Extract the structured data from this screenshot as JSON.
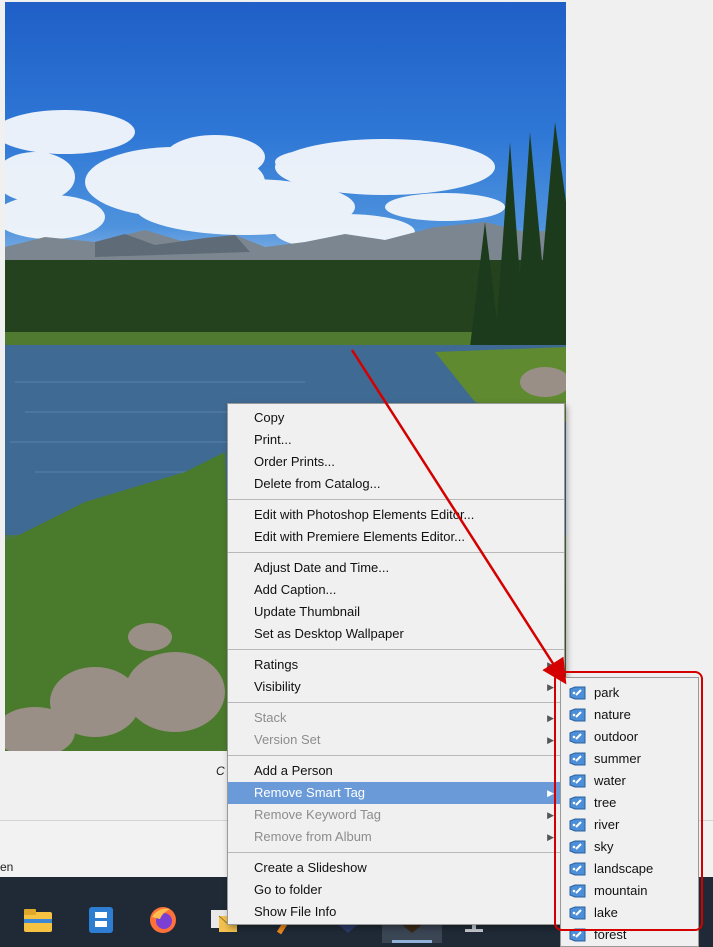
{
  "caption": "C",
  "status_text": "en",
  "context_menu": {
    "groups": [
      [
        {
          "label": "Copy",
          "disabled": false,
          "submenu": false
        },
        {
          "label": "Print...",
          "disabled": false,
          "submenu": false
        },
        {
          "label": "Order Prints...",
          "disabled": false,
          "submenu": false
        },
        {
          "label": "Delete from Catalog...",
          "disabled": false,
          "submenu": false
        }
      ],
      [
        {
          "label": "Edit with Photoshop Elements Editor...",
          "disabled": false,
          "submenu": false
        },
        {
          "label": "Edit with Premiere Elements Editor...",
          "disabled": false,
          "submenu": false
        }
      ],
      [
        {
          "label": "Adjust Date and Time...",
          "disabled": false,
          "submenu": false
        },
        {
          "label": "Add Caption...",
          "disabled": false,
          "submenu": false
        },
        {
          "label": "Update Thumbnail",
          "disabled": false,
          "submenu": false
        },
        {
          "label": "Set as Desktop Wallpaper",
          "disabled": false,
          "submenu": false
        }
      ],
      [
        {
          "label": "Ratings",
          "disabled": false,
          "submenu": true
        },
        {
          "label": "Visibility",
          "disabled": false,
          "submenu": true
        }
      ],
      [
        {
          "label": "Stack",
          "disabled": true,
          "submenu": true
        },
        {
          "label": "Version Set",
          "disabled": true,
          "submenu": true
        }
      ],
      [
        {
          "label": "Add a Person",
          "disabled": false,
          "submenu": false
        },
        {
          "label": "Remove Smart Tag",
          "disabled": false,
          "submenu": true,
          "highlighted": true
        },
        {
          "label": "Remove Keyword Tag",
          "disabled": true,
          "submenu": true
        },
        {
          "label": "Remove from Album",
          "disabled": true,
          "submenu": true
        }
      ],
      [
        {
          "label": "Create a Slideshow",
          "disabled": false,
          "submenu": false
        },
        {
          "label": "Go to folder",
          "disabled": false,
          "submenu": false
        },
        {
          "label": "Show File Info",
          "disabled": false,
          "submenu": false
        }
      ]
    ]
  },
  "smart_tags": [
    "park",
    "nature",
    "outdoor",
    "summer",
    "water",
    "tree",
    "river",
    "sky",
    "landscape",
    "mountain",
    "lake",
    "forest"
  ],
  "taskbar": {
    "icons": [
      "file-explorer-icon",
      "app-grid-icon",
      "firefox-icon",
      "mail-icon",
      "app-icon",
      "photoshop-elements-icon",
      "premiere-elements-icon",
      "network-icon",
      "app-icon-2"
    ]
  },
  "colors": {
    "menu_bg": "#f0f0f0",
    "menu_highlight": "#6a9bd8",
    "annotation_red": "#d40000",
    "taskbar": "#1f2a36"
  }
}
